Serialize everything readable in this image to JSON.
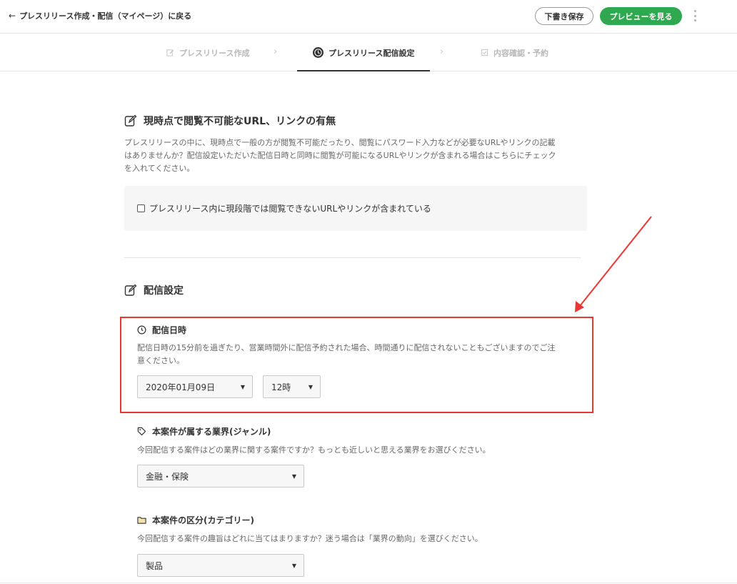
{
  "header": {
    "back_label": "プレスリリース作成・配信（マイページ）に戻る",
    "draft_button": "下書き保存",
    "preview_button": "プレビューを見る"
  },
  "steps": [
    {
      "label": "プレスリリース作成",
      "state": "inactive",
      "icon": "edit-icon"
    },
    {
      "label": "プレスリリース配信設定",
      "state": "active",
      "icon": "clock-icon"
    },
    {
      "label": "内容確認・予約",
      "state": "inactive",
      "icon": "check-doc-icon"
    }
  ],
  "url_section": {
    "title": "現時点で閲覧不可能なURL、リンクの有無",
    "description_lines": [
      "プレスリリースの中に、現時点で一般の方が閲覧不可能だったり、閲覧にパスワード入力などが必要なURLやリンクの記載",
      "はありませんか？配信設定いただいた配信日時と同時に閲覧が可能になるURLやリンクが含まれる場合はこちらにチェック",
      "を入れてください。"
    ],
    "checkbox_label": "プレスリリース内に現段階では閲覧できないURLやリンクが含まれている",
    "checked": false
  },
  "delivery_section": {
    "title": "配信設定",
    "datetime": {
      "title": "配信日時",
      "description_lines": [
        "配信日時の15分前を過ぎたり、営業時間外に配信予約された場合、時間通りに配信されないこともございますのでご注",
        "意ください。"
      ],
      "date_value": "2020年01月09日",
      "hour_value": "12時"
    },
    "genre": {
      "title": "本案件が属する業界(ジャンル)",
      "description": "今回配信する案件はどの業界に関する案件ですか？もっとも近しいと思える業界をお選びください。",
      "value": "金融・保険"
    },
    "category": {
      "title": "本案件の区分(カテゴリー)",
      "description": "今回配信する案件の趣旨はどれに当てはまりますか？迷う場合は「業界の動向」を選びください。",
      "value": "製品"
    }
  },
  "colors": {
    "accent_green": "#2fa84f",
    "highlight_red": "#e53935",
    "text_dark": "#333333"
  }
}
